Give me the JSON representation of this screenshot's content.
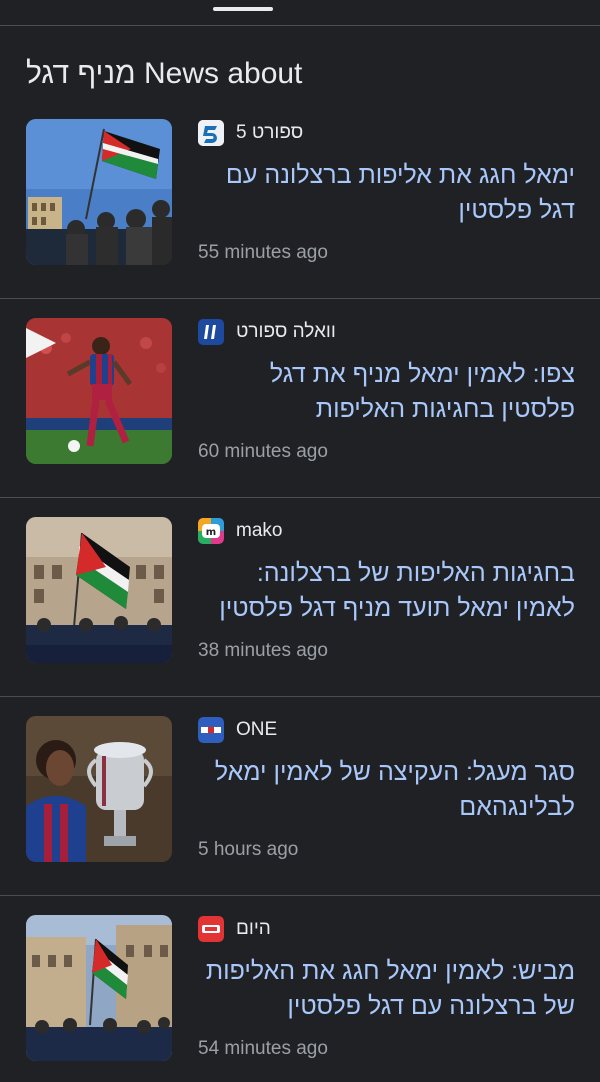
{
  "header": {
    "title_prefix": "News about",
    "title_query": "מניף דגל"
  },
  "articles": [
    {
      "source": "ספורט 5",
      "source_icon": "sport5-logo-icon",
      "headline": "ימאל חגג את אליפות ברצלונה עם דגל פלסטין",
      "time": "55 minutes ago",
      "thumbnail": "crowd-with-palestinian-flag-image"
    },
    {
      "source": "וואלה ספורט",
      "source_icon": "walla-sport-logo-icon",
      "headline": "צפו: לאמין ימאל מניף את דגל פלסטין בחגיגות האליפות",
      "time": "60 minutes ago",
      "thumbnail": "soccer-player-dribbling-image"
    },
    {
      "source": "mako",
      "source_icon": "mako-logo-icon",
      "headline": "בחגיגות האליפות של ברצלונה: לאמין ימאל תועד מניף דגל פלסטין",
      "time": "38 minutes ago",
      "thumbnail": "parade-bus-with-flag-image"
    },
    {
      "source": "ONE",
      "source_icon": "one-logo-icon",
      "headline": "סגר מעגל: העקיצה של לאמין ימאל לבלינגהאם",
      "time": "5 hours ago",
      "thumbnail": "player-with-trophy-image"
    },
    {
      "source": "היום",
      "source_icon": "hayom-logo-icon",
      "headline": "מביש: לאמין ימאל חגג את האליפות של ברצלונה עם דגל פלסטין",
      "time": "54 minutes ago",
      "thumbnail": "parade-street-with-flag-image"
    }
  ]
}
